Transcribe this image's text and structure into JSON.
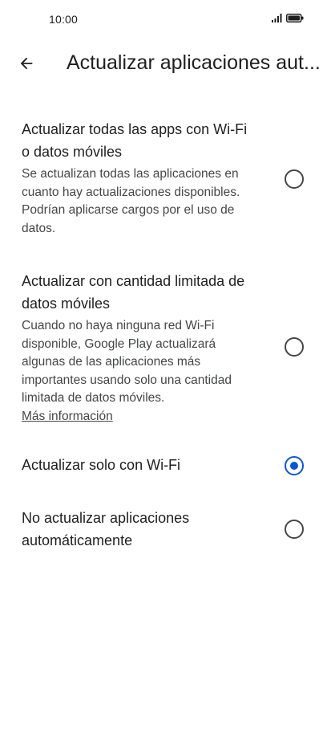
{
  "status_bar": {
    "time": "10:00"
  },
  "header": {
    "title": "Actualizar aplicaciones aut..."
  },
  "options": [
    {
      "title": "Actualizar todas las apps con Wi-Fi o datos móviles",
      "description": "Se actualizan todas las aplicaciones en cuanto hay actualizaciones disponibles. Podrían aplicarse cargos por el uso de datos.",
      "selected": false
    },
    {
      "title": "Actualizar con cantidad limitada de datos móviles",
      "description": "Cuando no haya ninguna red Wi-Fi disponible, Google Play actualizará algunas de las aplicaciones más importantes usando solo una cantidad limitada de datos móviles.",
      "link": "Más información",
      "selected": false
    },
    {
      "title": "Actualizar solo con Wi-Fi",
      "selected": true
    },
    {
      "title": "No actualizar aplicaciones automáticamente",
      "selected": false
    }
  ],
  "colors": {
    "accent": "#0b57d0",
    "text_primary": "#1f1f1f",
    "text_secondary": "#444746",
    "background": "#ffffff"
  },
  "icons": {
    "back": "arrow-back-icon",
    "signal": "signal-icon",
    "battery": "battery-icon"
  }
}
